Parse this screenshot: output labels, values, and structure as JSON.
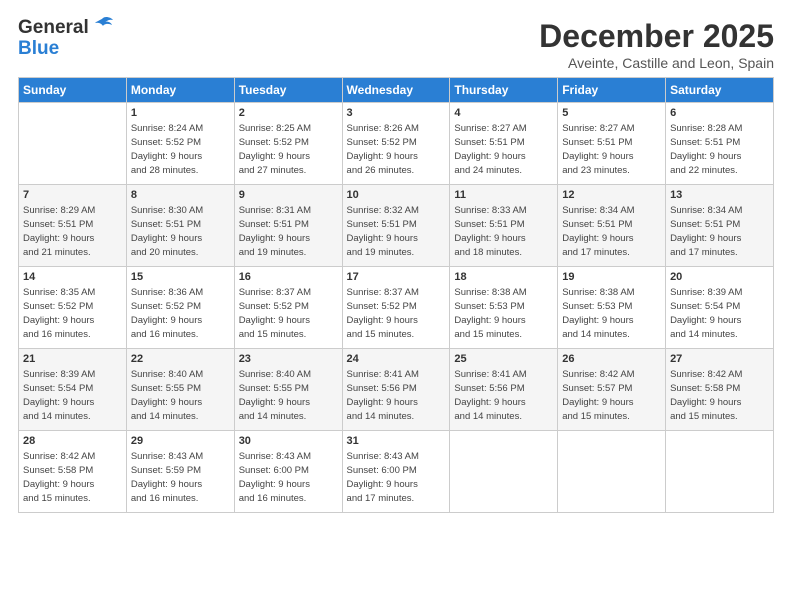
{
  "header": {
    "logo_line1": "General",
    "logo_line2": "Blue",
    "title": "December 2025",
    "subtitle": "Aveinte, Castille and Leon, Spain"
  },
  "days_of_week": [
    "Sunday",
    "Monday",
    "Tuesday",
    "Wednesday",
    "Thursday",
    "Friday",
    "Saturday"
  ],
  "weeks": [
    [
      {
        "day": "",
        "info": ""
      },
      {
        "day": "1",
        "info": "Sunrise: 8:24 AM\nSunset: 5:52 PM\nDaylight: 9 hours\nand 28 minutes."
      },
      {
        "day": "2",
        "info": "Sunrise: 8:25 AM\nSunset: 5:52 PM\nDaylight: 9 hours\nand 27 minutes."
      },
      {
        "day": "3",
        "info": "Sunrise: 8:26 AM\nSunset: 5:52 PM\nDaylight: 9 hours\nand 26 minutes."
      },
      {
        "day": "4",
        "info": "Sunrise: 8:27 AM\nSunset: 5:51 PM\nDaylight: 9 hours\nand 24 minutes."
      },
      {
        "day": "5",
        "info": "Sunrise: 8:27 AM\nSunset: 5:51 PM\nDaylight: 9 hours\nand 23 minutes."
      },
      {
        "day": "6",
        "info": "Sunrise: 8:28 AM\nSunset: 5:51 PM\nDaylight: 9 hours\nand 22 minutes."
      }
    ],
    [
      {
        "day": "7",
        "info": "Sunrise: 8:29 AM\nSunset: 5:51 PM\nDaylight: 9 hours\nand 21 minutes."
      },
      {
        "day": "8",
        "info": "Sunrise: 8:30 AM\nSunset: 5:51 PM\nDaylight: 9 hours\nand 20 minutes."
      },
      {
        "day": "9",
        "info": "Sunrise: 8:31 AM\nSunset: 5:51 PM\nDaylight: 9 hours\nand 19 minutes."
      },
      {
        "day": "10",
        "info": "Sunrise: 8:32 AM\nSunset: 5:51 PM\nDaylight: 9 hours\nand 19 minutes."
      },
      {
        "day": "11",
        "info": "Sunrise: 8:33 AM\nSunset: 5:51 PM\nDaylight: 9 hours\nand 18 minutes."
      },
      {
        "day": "12",
        "info": "Sunrise: 8:34 AM\nSunset: 5:51 PM\nDaylight: 9 hours\nand 17 minutes."
      },
      {
        "day": "13",
        "info": "Sunrise: 8:34 AM\nSunset: 5:51 PM\nDaylight: 9 hours\nand 17 minutes."
      }
    ],
    [
      {
        "day": "14",
        "info": "Sunrise: 8:35 AM\nSunset: 5:52 PM\nDaylight: 9 hours\nand 16 minutes."
      },
      {
        "day": "15",
        "info": "Sunrise: 8:36 AM\nSunset: 5:52 PM\nDaylight: 9 hours\nand 16 minutes."
      },
      {
        "day": "16",
        "info": "Sunrise: 8:37 AM\nSunset: 5:52 PM\nDaylight: 9 hours\nand 15 minutes."
      },
      {
        "day": "17",
        "info": "Sunrise: 8:37 AM\nSunset: 5:52 PM\nDaylight: 9 hours\nand 15 minutes."
      },
      {
        "day": "18",
        "info": "Sunrise: 8:38 AM\nSunset: 5:53 PM\nDaylight: 9 hours\nand 15 minutes."
      },
      {
        "day": "19",
        "info": "Sunrise: 8:38 AM\nSunset: 5:53 PM\nDaylight: 9 hours\nand 14 minutes."
      },
      {
        "day": "20",
        "info": "Sunrise: 8:39 AM\nSunset: 5:54 PM\nDaylight: 9 hours\nand 14 minutes."
      }
    ],
    [
      {
        "day": "21",
        "info": "Sunrise: 8:39 AM\nSunset: 5:54 PM\nDaylight: 9 hours\nand 14 minutes."
      },
      {
        "day": "22",
        "info": "Sunrise: 8:40 AM\nSunset: 5:55 PM\nDaylight: 9 hours\nand 14 minutes."
      },
      {
        "day": "23",
        "info": "Sunrise: 8:40 AM\nSunset: 5:55 PM\nDaylight: 9 hours\nand 14 minutes."
      },
      {
        "day": "24",
        "info": "Sunrise: 8:41 AM\nSunset: 5:56 PM\nDaylight: 9 hours\nand 14 minutes."
      },
      {
        "day": "25",
        "info": "Sunrise: 8:41 AM\nSunset: 5:56 PM\nDaylight: 9 hours\nand 14 minutes."
      },
      {
        "day": "26",
        "info": "Sunrise: 8:42 AM\nSunset: 5:57 PM\nDaylight: 9 hours\nand 15 minutes."
      },
      {
        "day": "27",
        "info": "Sunrise: 8:42 AM\nSunset: 5:58 PM\nDaylight: 9 hours\nand 15 minutes."
      }
    ],
    [
      {
        "day": "28",
        "info": "Sunrise: 8:42 AM\nSunset: 5:58 PM\nDaylight: 9 hours\nand 15 minutes."
      },
      {
        "day": "29",
        "info": "Sunrise: 8:43 AM\nSunset: 5:59 PM\nDaylight: 9 hours\nand 16 minutes."
      },
      {
        "day": "30",
        "info": "Sunrise: 8:43 AM\nSunset: 6:00 PM\nDaylight: 9 hours\nand 16 minutes."
      },
      {
        "day": "31",
        "info": "Sunrise: 8:43 AM\nSunset: 6:00 PM\nDaylight: 9 hours\nand 17 minutes."
      },
      {
        "day": "",
        "info": ""
      },
      {
        "day": "",
        "info": ""
      },
      {
        "day": "",
        "info": ""
      }
    ]
  ]
}
